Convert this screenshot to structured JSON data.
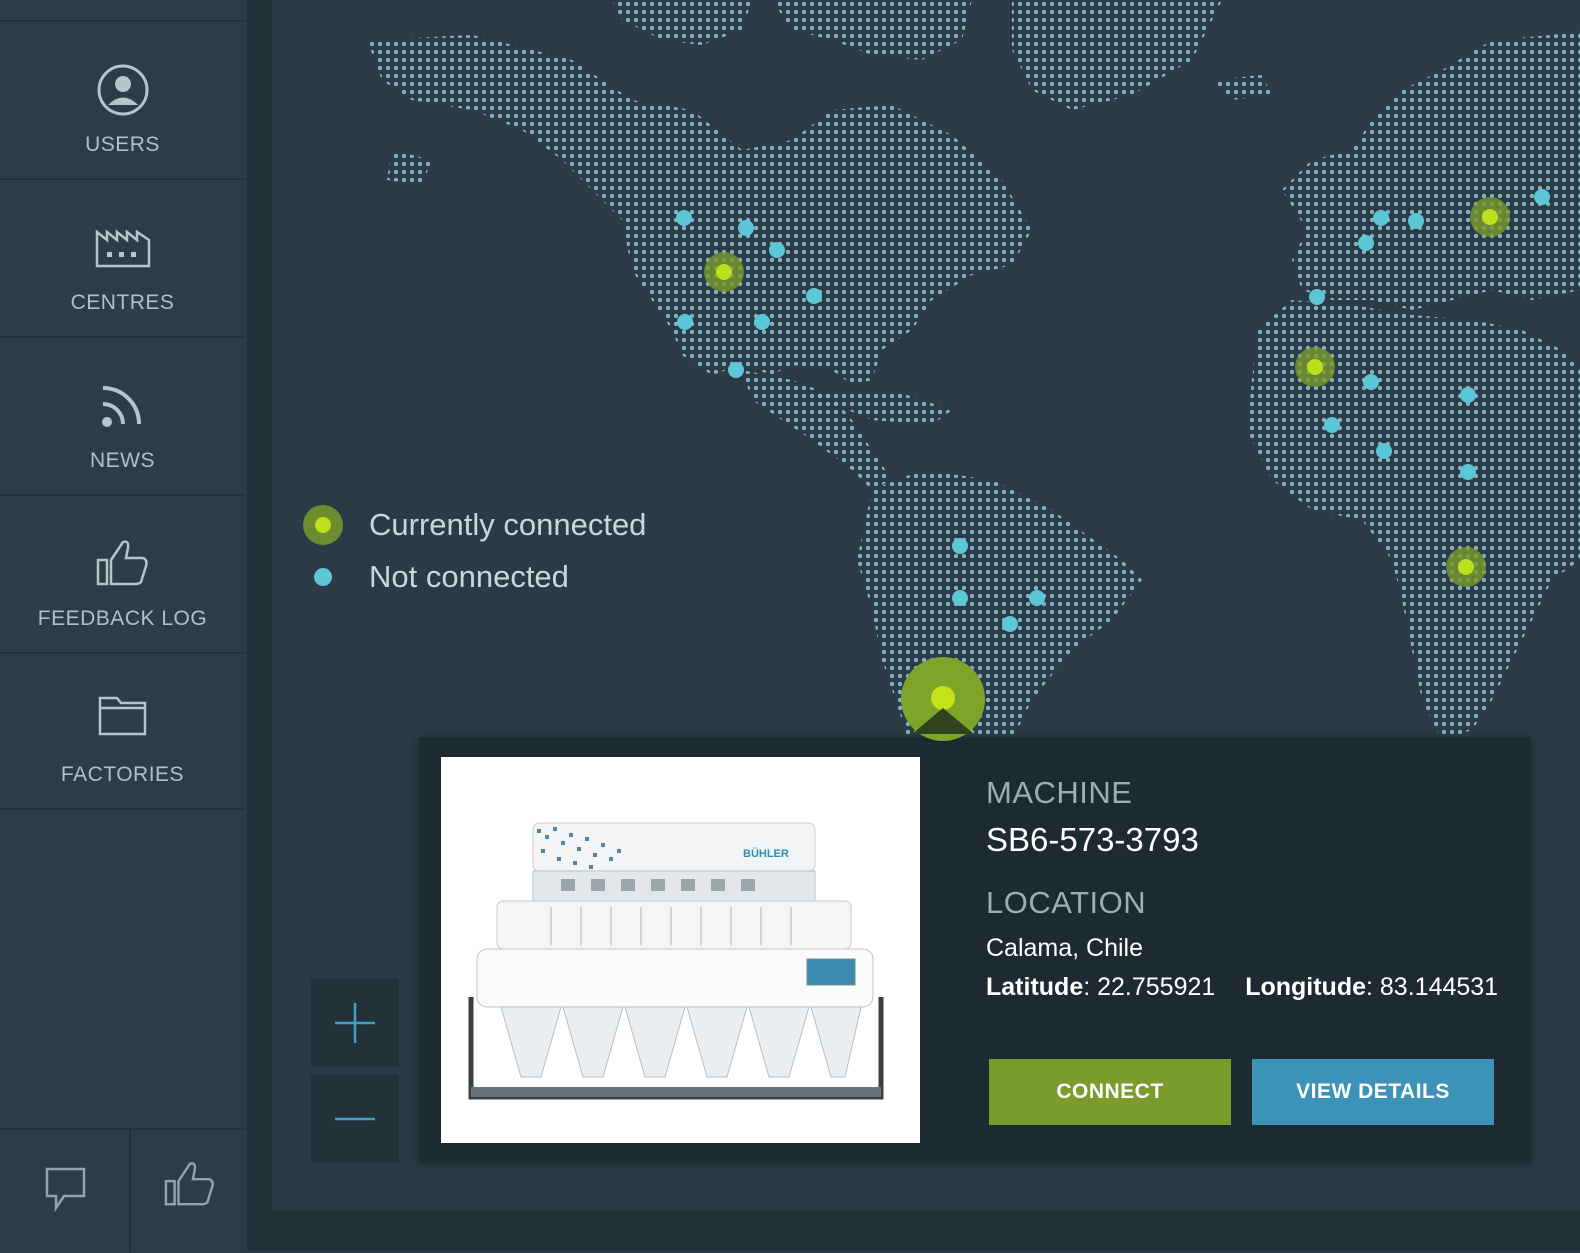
{
  "sidebar": {
    "items": [
      {
        "label": "USERS",
        "icon": "user-icon"
      },
      {
        "label": "CENTRES",
        "icon": "factory-icon"
      },
      {
        "label": "NEWS",
        "icon": "rss-icon"
      },
      {
        "label": "FEEDBACK LOG",
        "icon": "thumbs-up-icon"
      },
      {
        "label": "FACTORIES",
        "icon": "folder-icon"
      }
    ],
    "bottom": [
      {
        "icon": "chat-bubble-icon"
      },
      {
        "icon": "thumbs-up-icon"
      }
    ]
  },
  "legend": {
    "connected": "Currently connected",
    "not_connected": "Not connected"
  },
  "zoom": {
    "in_icon": "plus-icon",
    "out_icon": "minus-icon"
  },
  "popup": {
    "machine_label": "MACHINE",
    "machine_id": "SB6-573-3793",
    "location_label": "LOCATION",
    "city": "Calama, Chile",
    "latitude_label": "Latitude",
    "latitude": ": 22.755921",
    "longitude_label": "Longitude",
    "longitude": ": 83.144531",
    "connect_label": "CONNECT",
    "details_label": "VIEW DETAILS",
    "brand": "BÜHLER"
  },
  "colors": {
    "background": "#2b3a44",
    "map_dots": "#7fb4c8",
    "connected": "#a6c31c",
    "not_connected": "#5bc6d6",
    "connect_button": "#7b9c2b",
    "details_button": "#3c93b7"
  }
}
